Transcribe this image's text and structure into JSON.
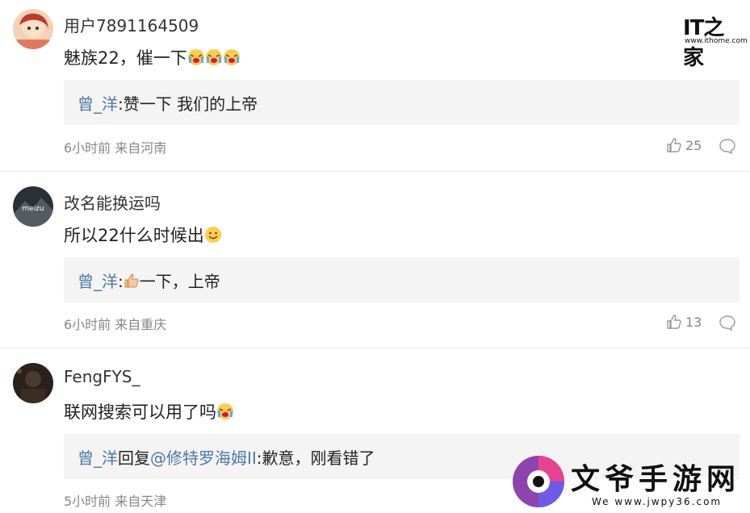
{
  "watermark_top": {
    "brand": "IT之家",
    "url": "www.ithome.com"
  },
  "comments": [
    {
      "username": "用户7891164509",
      "avatar": "avatar-girl",
      "content": "魅族22，催一下",
      "content_emojis": [
        "crying-face-emoji",
        "crying-face-emoji",
        "crying-face-emoji"
      ],
      "reply": {
        "name": "曾_洋",
        "sep": ":",
        "text": "赞一下 我们的上帝"
      },
      "meta": "6小时前 来自河南",
      "likes": "25"
    },
    {
      "username": "改名能换运吗",
      "avatar": "avatar-meizu",
      "avatar_text": "meizu",
      "content": "所以22什么时候出",
      "content_emojis": [
        "smile-emoji"
      ],
      "reply": {
        "name": "曾_洋",
        "sep": ":",
        "text": "一下，上帝",
        "emoji": "thumbs-up-emoji"
      },
      "meta": "6小时前 来自重庆",
      "likes": "13"
    },
    {
      "username": "FengFYS_",
      "avatar": "avatar-dark",
      "content": "联网搜索可以用了吗",
      "content_emojis": [
        "crying-face-emoji"
      ],
      "reply": {
        "name": "曾_洋",
        "action": "回复",
        "mention": "@修特罗海姆II",
        "sep": ":",
        "text": "歉意，刚看错了"
      },
      "meta": "5小时前 来自天津"
    }
  ],
  "watermark_bottom": {
    "title": "文爷手游网",
    "url": "www.jwpy36.com",
    "prefix": "We"
  },
  "colors": {
    "link": "#4e7aa8",
    "meta": "#888888",
    "reply_bg": "#f4f4f4"
  }
}
